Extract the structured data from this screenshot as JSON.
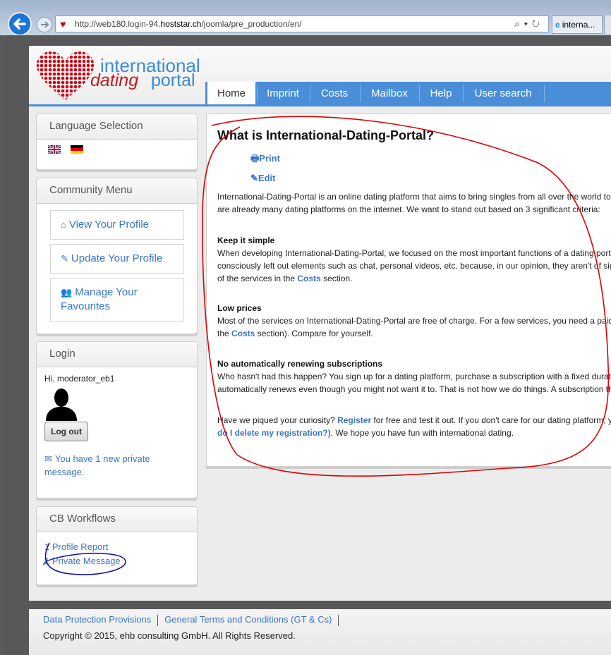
{
  "browser": {
    "url_prefix": "http://web180.login-94.",
    "url_host": "hoststar.ch",
    "url_path": "/joomla/pre_production/en/",
    "tab_title": "interna..."
  },
  "logo": {
    "line1": "international",
    "line2a": "dating",
    "line2b": "portal"
  },
  "nav": {
    "items": [
      "Home",
      "Imprint",
      "Costs",
      "Mailbox",
      "Help",
      "User search"
    ],
    "active": "Home"
  },
  "language": {
    "title": "Language Selection"
  },
  "community": {
    "title": "Community Menu",
    "view": "View Your Profile",
    "update": "Update Your Profile",
    "fav1": "Manage Your",
    "fav2": "Favourites"
  },
  "login": {
    "title": "Login",
    "greeting": "Hi, moderator_eb1",
    "logout": "Log out",
    "msg1": "You have 1 new private",
    "msg2": "message."
  },
  "cb": {
    "title": "CB Workflows",
    "item1": "1 Profile Report",
    "item2": "1 Private Message"
  },
  "article": {
    "title": "What is International-Dating-Portal?",
    "print": "Print",
    "edit": "Edit",
    "intro1": "International-Dating-Portal is an online dating platform that aims to bring singles from all over the world togeth",
    "intro2": "are already many dating platforms on the internet. We want to stand out based on 3 significant criteria:",
    "h1": "Keep it simple",
    "p1a": "When developing International-Dating-Portal, we focused on the most important functions of a dating portal an",
    "p1b": "consciously left out elements such as chat, personal videos, etc. because, in our opinion, they aren't of signific",
    "p1c_pre": "of the services in the ",
    "p1c_link": "Costs",
    "p1c_post": " section.",
    "h2": "Low prices",
    "p2a": "Most of the services on International-Dating-Portal are free of charge. For a few services, you need a paid sub",
    "p2b_pre": "the ",
    "p2b_link": "Costs",
    "p2b_post": " section). Compare for yourself.",
    "h3": "No automatically renewing subscriptions",
    "p3a": "Who hasn't had this happen? You sign up for a dating platform, purchase a subscription with a fixed duration a",
    "p3b": "automatically renews even though you might not want it to. That is not how we do things. A subscription that e",
    "p4a_pre": "Have we piqued your curiosity? ",
    "p4a_link": "Register",
    "p4a_post": " for free and test it out. If you don't care for our dating platform, you d",
    "p4b_link": "do I delete my registration?",
    "p4b_post": "). We hope you have fun with international dating."
  },
  "footer": {
    "link1": "Data Protection Provisions",
    "link2": "General Terms and Conditions (GT & Cs)",
    "copyright": "Copyright © 2015, ehb consulting GmbH. All Rights Reserved."
  },
  "colors": {
    "accent": "#4a8ed9",
    "link": "#3a76c5",
    "logo_red": "#d10010",
    "annotation_red": "#e00000",
    "annotation_blue": "#1010b0"
  }
}
